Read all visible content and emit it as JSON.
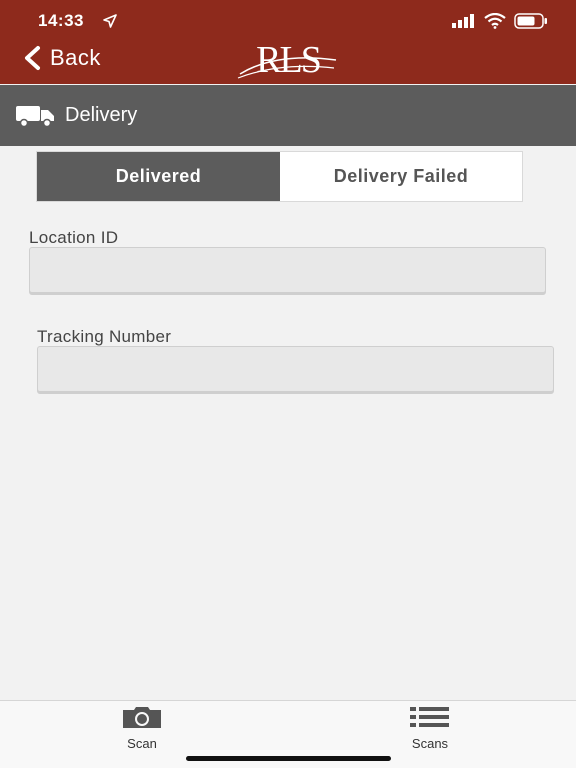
{
  "status_bar": {
    "time": "14:33"
  },
  "nav": {
    "back_label": "Back",
    "logo_text": "RLS"
  },
  "section": {
    "title": "Delivery"
  },
  "segments": {
    "delivered": "Delivered",
    "failed": "Delivery Failed",
    "selected": "Delivered"
  },
  "fields": {
    "location_id": {
      "label": "Location ID",
      "value": ""
    },
    "tracking_number": {
      "label": "Tracking Number",
      "value": ""
    }
  },
  "tabbar": {
    "scan_label": "Scan",
    "scans_label": "Scans"
  },
  "colors": {
    "brand": "#8e2a1c",
    "header_gray": "#5c5c5c",
    "background": "#f2f2f2"
  }
}
